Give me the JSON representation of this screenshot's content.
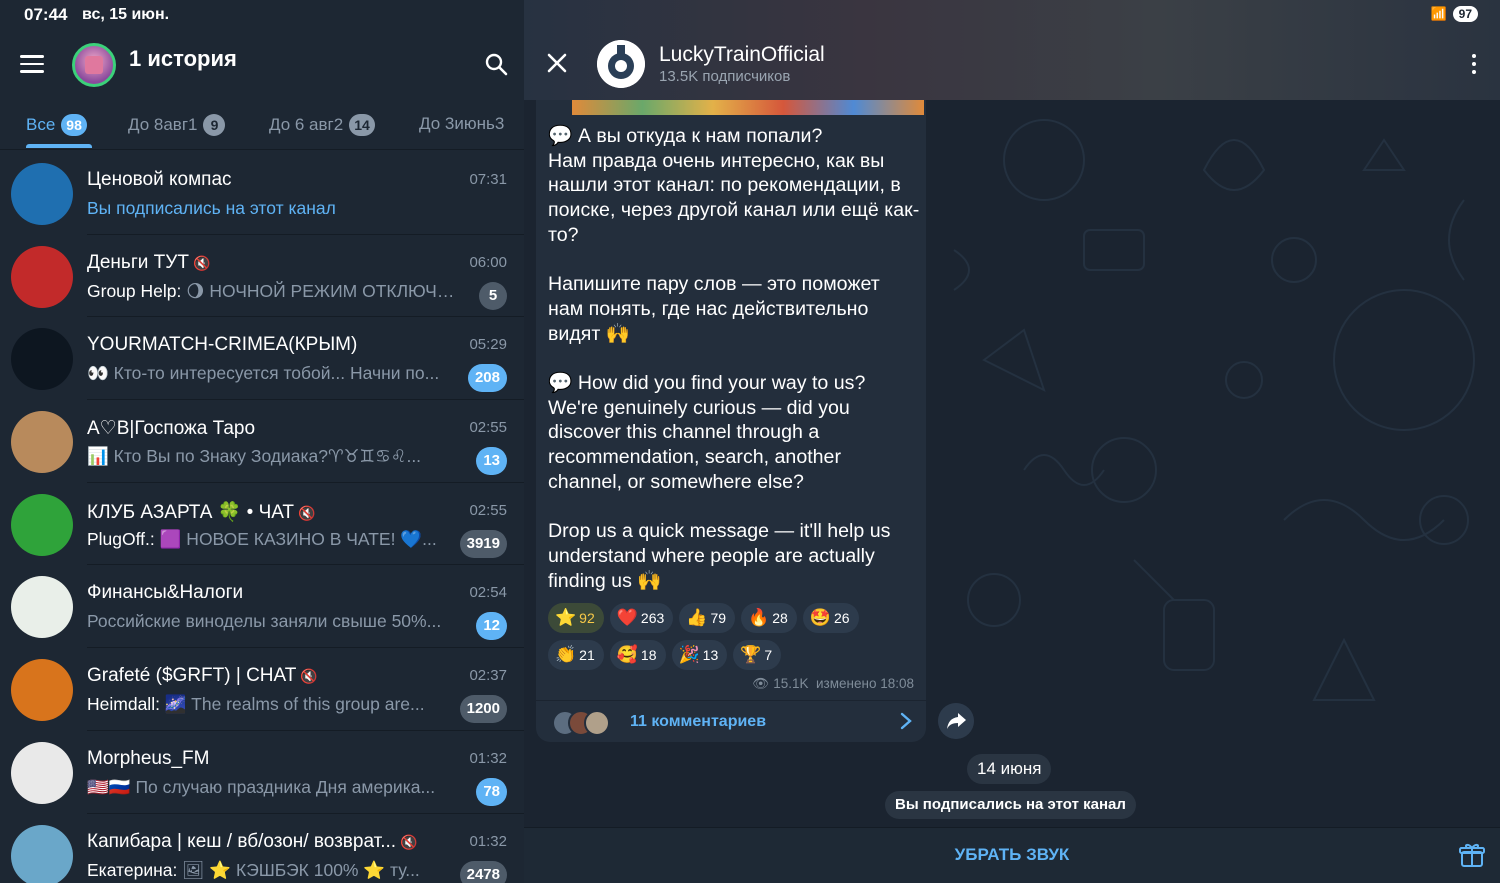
{
  "status_bar": {
    "time": "07:44",
    "date": "вс, 15 июн.",
    "battery": "97"
  },
  "left": {
    "header_title": "1 история",
    "tabs": [
      {
        "label": "Все",
        "count": "98"
      },
      {
        "label": "До 8авг1",
        "count": "9"
      },
      {
        "label": "До 6 авг2",
        "count": "14"
      },
      {
        "label": "До 3июнь3",
        "count": ""
      }
    ],
    "chats": [
      {
        "name": "Ценовой компас",
        "time": "07:31",
        "sender": "",
        "preview": "Вы подписались на этот канал",
        "count": "",
        "muted": false,
        "avatar_color": "#1f6fb0"
      },
      {
        "name": "Деньги ТУТ",
        "time": "06:00",
        "sender": "Group Help:",
        "preview": "🌖 НОЧНОЙ РЕЖИМ ОТКЛЮЧЕН",
        "count": "5",
        "muted": true,
        "avatar_color": "#c22a2a"
      },
      {
        "name": "YOURMATCH-CRIMEA(КРЫМ)",
        "time": "05:29",
        "sender": "",
        "preview": "👀 Кто-то интересуется тобой... Начни по...",
        "count": "208",
        "muted": false,
        "avatar_color": "#0d1620"
      },
      {
        "name": "A♡B|Госпожа Таро",
        "time": "02:55",
        "sender": "",
        "preview": "📊 Кто Вы по Знаку Зодиака?♈♉♊♋♌...",
        "count": "13",
        "muted": false,
        "avatar_color": "#b88a5c"
      },
      {
        "name": "КЛУБ АЗАРТА 🍀 • ЧАТ",
        "time": "02:55",
        "sender": "PlugOff.:",
        "preview": "🟪 НОВОЕ КАЗИНО В ЧАТЕ! 💙...",
        "count": "3919",
        "muted": true,
        "avatar_color": "#2fa33a"
      },
      {
        "name": "Финансы&Налоги",
        "time": "02:54",
        "sender": "",
        "preview": "Российские виноделы заняли свыше 50%...",
        "count": "12",
        "muted": false,
        "avatar_color": "#e9efe9"
      },
      {
        "name": "Grafeté ($GRFT) | CHAT",
        "time": "02:37",
        "sender": "Heimdall:",
        "preview": "🌌 The realms of this group are...",
        "count": "1200",
        "muted": true,
        "avatar_color": "#d8741c"
      },
      {
        "name": "Morpheus_FM",
        "time": "01:32",
        "sender": "",
        "preview": "🇺🇸🇷🇺 По случаю праздника Дня америка...",
        "count": "78",
        "muted": false,
        "avatar_color": "#e9e9e9"
      },
      {
        "name": "Капибара | кеш / вб/озон/ возврат...",
        "time": "01:32",
        "sender": "Екатерина:",
        "preview": "🖼 ⭐ КЭШБЭК 100% ⭐ ту...",
        "count": "2478",
        "muted": true,
        "avatar_color": "#6aa7c9"
      }
    ]
  },
  "right": {
    "channel_name": "LuckyTrainOfficial",
    "subscribers": "13.5K подписчиков",
    "post_text": "💬 А вы откуда к нам попали?\nНам правда очень интересно, как вы нашли этот канал: по рекомендации, в поиске, через другой канал или ещё как-то?\n\nНапишите пару слов — это поможет нам понять, где нас действительно видят 🙌\n\n💬 How did you find your way to us?\nWe're genuinely curious — did you discover this channel through a recommendation, search, another channel, or somewhere else?\n\nDrop us a quick message — it'll help us understand where people are actually finding us 🙌",
    "reactions": [
      {
        "emoji": "⭐",
        "count": "92",
        "selected": true
      },
      {
        "emoji": "❤️",
        "count": "263",
        "selected": false
      },
      {
        "emoji": "👍",
        "count": "79",
        "selected": false
      },
      {
        "emoji": "🔥",
        "count": "28",
        "selected": false
      },
      {
        "emoji": "🤩",
        "count": "26",
        "selected": false
      },
      {
        "emoji": "👏",
        "count": "21",
        "selected": false
      },
      {
        "emoji": "🥰",
        "count": "18",
        "selected": false
      },
      {
        "emoji": "🎉",
        "count": "13",
        "selected": false
      },
      {
        "emoji": "🏆",
        "count": "7",
        "selected": false
      }
    ],
    "views": "15.1K",
    "edited": "изменено 18:08",
    "comments_label": "11 комментариев",
    "date_pill": "14 июня",
    "service_message": "Вы подписались на этот канал",
    "unmute_label": "УБРАТЬ ЗВУК"
  }
}
